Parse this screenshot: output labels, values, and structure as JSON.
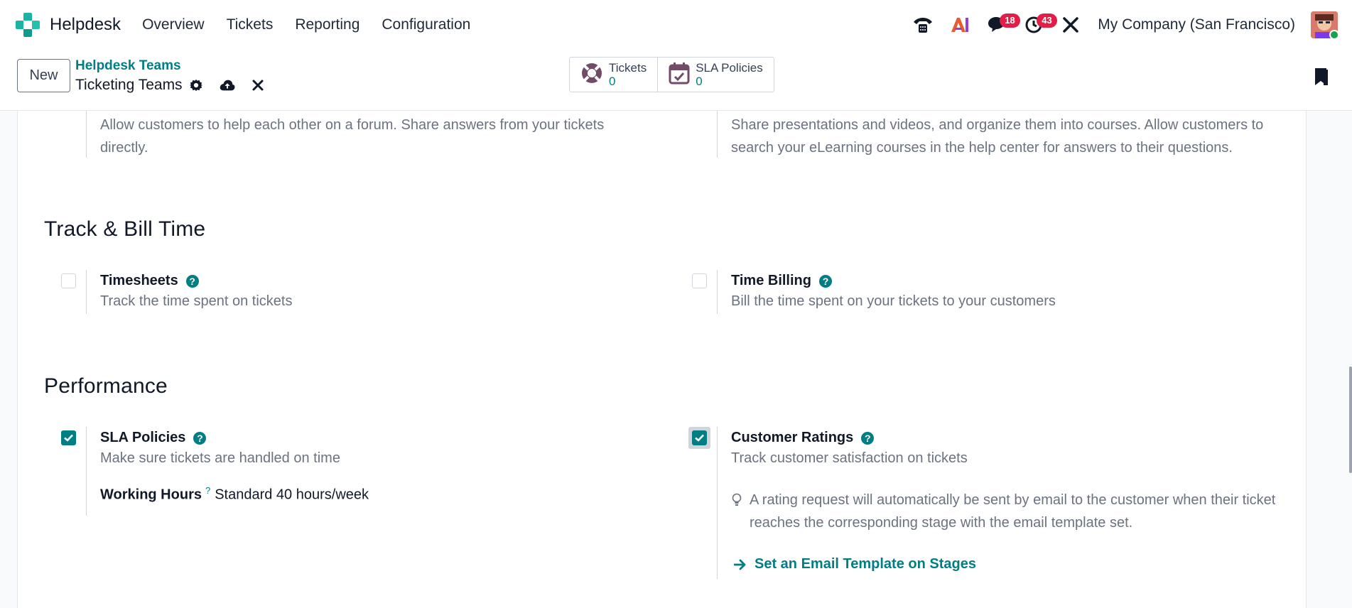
{
  "navbar": {
    "app_name": "Helpdesk",
    "menu": [
      "Overview",
      "Tickets",
      "Reporting",
      "Configuration"
    ],
    "badges": {
      "messages": "18",
      "activities": "43"
    },
    "company": "My Company (San Francisco)"
  },
  "control_panel": {
    "new_label": "New",
    "breadcrumb_parent": "Helpdesk Teams",
    "breadcrumb_current": "Ticketing Teams",
    "smart_buttons": [
      {
        "label": "Tickets",
        "count": "0"
      },
      {
        "label": "SLA Policies",
        "count": "0"
      }
    ]
  },
  "sections": {
    "top_left_desc": "Allow customers to help each other on a forum. Share answers from your tickets directly.",
    "top_right_desc": "Share presentations and videos, and organize them into courses. Allow customers to search your eLearning courses in the help center for answers to their questions.",
    "track_title": "Track & Bill Time",
    "timesheets": {
      "title": "Timesheets",
      "desc": "Track the time spent on tickets",
      "checked": false
    },
    "time_billing": {
      "title": "Time Billing",
      "desc": "Bill the time spent on your tickets to your customers",
      "checked": false
    },
    "performance_title": "Performance",
    "sla": {
      "title": "SLA Policies",
      "desc": "Make sure tickets are handled on time",
      "checked": true,
      "working_hours_label": "Working Hours",
      "working_hours_value": "Standard 40 hours/week"
    },
    "ratings": {
      "title": "Customer Ratings",
      "desc": "Track customer satisfaction on tickets",
      "checked": true,
      "note": "A rating request will automatically be sent by email to the customer when their ticket reaches the corresponding stage with the email template set.",
      "link": "Set an Email Template on Stages"
    }
  },
  "colors": {
    "accent": "#017e84",
    "badge": "#e11d48",
    "brand": "#714b67"
  }
}
